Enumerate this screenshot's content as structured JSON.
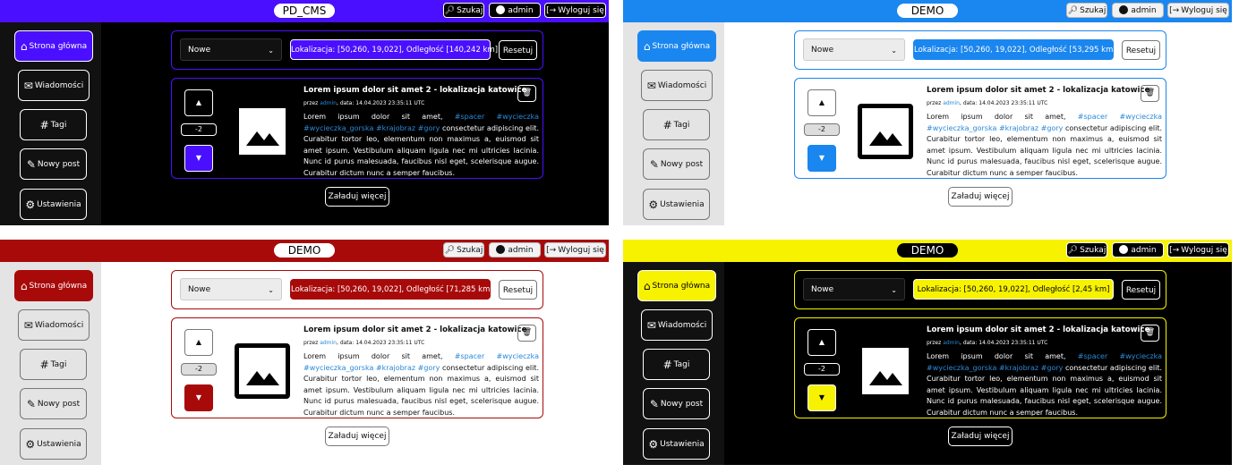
{
  "common": {
    "search_label": "Szukaj",
    "admin_label": "admin",
    "logout_label": "Wyloguj się",
    "nav": [
      "Strona główna",
      "Wiadomości",
      "Tagi",
      "Nowy post",
      "Ustawienia"
    ],
    "nav_icons": [
      "home-icon",
      "message-icon",
      "hash-icon",
      "new-post-icon",
      "gear-icon"
    ],
    "sort_value": "Nowe",
    "reset_label": "Resetuj",
    "post_title": "Lorem ipsum dolor sit amet 2 - lokalizacja katowice",
    "meta_prefix": "przez ",
    "meta_author": "admin",
    "meta_date": ", data: 14.04.2023 23:35:11 UTC",
    "score": "-2",
    "load_more_label": "Załaduj więcej",
    "body_start": "Lorem ipsum dolor sit amet, ",
    "tags": [
      "#spacer",
      "#wycieczka",
      "#wycieczka_gorska",
      "#krajobraz",
      "#gory"
    ],
    "body_rest": " consectetur adipiscing elit. Curabitur tortor leo, elementum non maximus a, euismod sit amet ipsum. Vestibulum aliquam ligula nec mi ultricies lacinia. Nunc id purus malesuada, faucibus nisl eget, scelerisque augue. Curabitur dictum nunc a semper faucibus."
  },
  "themes": [
    {
      "title": "PD_CMS",
      "location": "Lokalizacja: [50,260, 19,022], Odległość [140,242 km]",
      "accent": "#4a0fff",
      "header_bg": "#4a0fff",
      "page_bg": "#000000",
      "side_bg": "#111111",
      "text": "#ffffff",
      "title_bg": "#ffffff",
      "title_fg": "#000000"
    },
    {
      "title": "DEMO",
      "location": "Lokalizacja: [50,260, 19,022], Odległość [53,295 km]",
      "accent": "#1a86f0",
      "header_bg": "#1a86f0",
      "page_bg": "#ffffff",
      "side_bg": "#e4e4e4",
      "text": "#111111",
      "title_bg": "#ffffff",
      "title_fg": "#000000"
    },
    {
      "title": "DEMO",
      "location": "Lokalizacja: [50,260, 19,022], Odległość [71,285 km]",
      "accent": "#a80a0a",
      "header_bg": "#a80a0a",
      "page_bg": "#ffffff",
      "side_bg": "#e4e4e4",
      "text": "#111111",
      "title_bg": "#ffffff",
      "title_fg": "#000000"
    },
    {
      "title": "DEMO",
      "location": "Lokalizacja: [50,260, 19,022], Odległość [2,45 km]",
      "accent": "#f7f200",
      "header_bg": "#f7f200",
      "page_bg": "#000000",
      "side_bg": "#111111",
      "text": "#ffffff",
      "title_bg": "#000000",
      "title_fg": "#ffffff"
    }
  ]
}
